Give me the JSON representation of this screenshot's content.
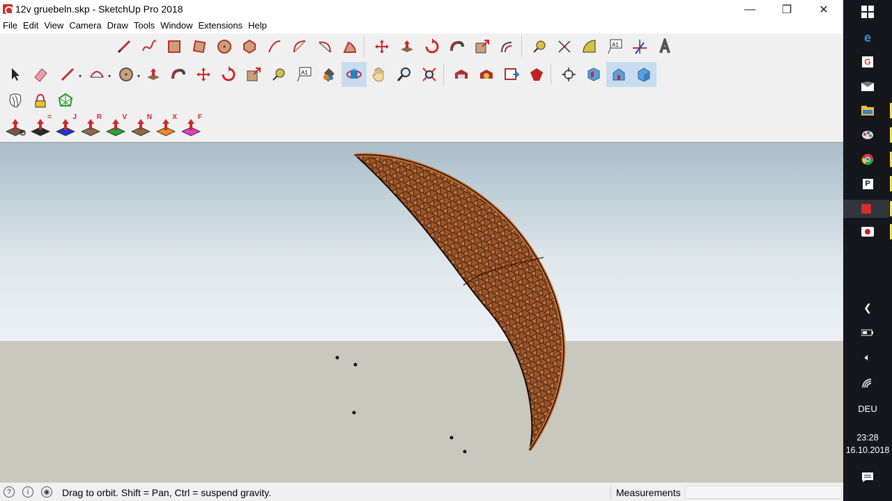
{
  "window": {
    "title": "12v gruebeln.skp - SketchUp Pro 2018",
    "controls": {
      "minimize": "—",
      "restore": "❐",
      "close": "✕"
    }
  },
  "menu": [
    "File",
    "Edit",
    "View",
    "Camera",
    "Draw",
    "Tools",
    "Window",
    "Extensions",
    "Help"
  ],
  "toolbar_rows": {
    "row1": [
      "pencil-icon",
      "freehand-icon",
      "rectangle-icon",
      "rotated-rect-icon",
      "circle-icon",
      "polygon-icon",
      "arc-icon",
      "two-point-arc-icon",
      "three-point-arc-icon",
      "pie-icon",
      "move-icon",
      "pushpull-icon",
      "rotate-icon",
      "followme-icon",
      "scale-icon",
      "offset-icon",
      "tape-measure-icon",
      "dimension-icon",
      "protractor-icon",
      "text-icon",
      "axes-icon",
      "3d-text-icon"
    ],
    "row2": [
      "select-icon",
      "eraser-icon",
      "pencil-dropdown-icon",
      "arc-dropdown-icon",
      "circle-dropdown-icon",
      "pushpull-icon",
      "followme-icon",
      "move-icon",
      "rotate-icon",
      "scale-icon",
      "tape-measure-icon",
      "text-icon",
      "paint-bucket-icon",
      "orbit-icon",
      "pan-icon",
      "zoom-icon",
      "zoom-extents-icon",
      "warehouse-icon",
      "extension-warehouse-icon",
      "layout-icon",
      "extension-manager-icon",
      "position-camera-icon",
      "iso-view-icon",
      "front-view-icon",
      "right-view-icon"
    ],
    "row3": [
      "sandbox-smoove-icon",
      "sandbox-stamp-icon",
      "sandbox-drape-icon"
    ],
    "row4_letters": [
      "",
      "=",
      "J",
      "R",
      "V",
      "N",
      "X",
      "F"
    ],
    "row4_colors": [
      "#6b5a45",
      "#2a2a2a",
      "#2233cc",
      "#8a6a4a",
      "#23a63a",
      "#8a6a4a",
      "#f08a20",
      "#e040c0"
    ]
  },
  "active_tool": "orbit-icon",
  "statusbar": {
    "hint": "Drag to orbit. Shift = Pan, Ctrl = suspend gravity.",
    "measurements_label": "Measurements",
    "measurements_value": ""
  },
  "taskbar": {
    "language": "DEU",
    "time": "23:28",
    "date": "16.10.2018"
  },
  "colors": {
    "shell": "#a5612e",
    "sky_top": "#a9bdc8",
    "ground": "#c9c8bf"
  }
}
